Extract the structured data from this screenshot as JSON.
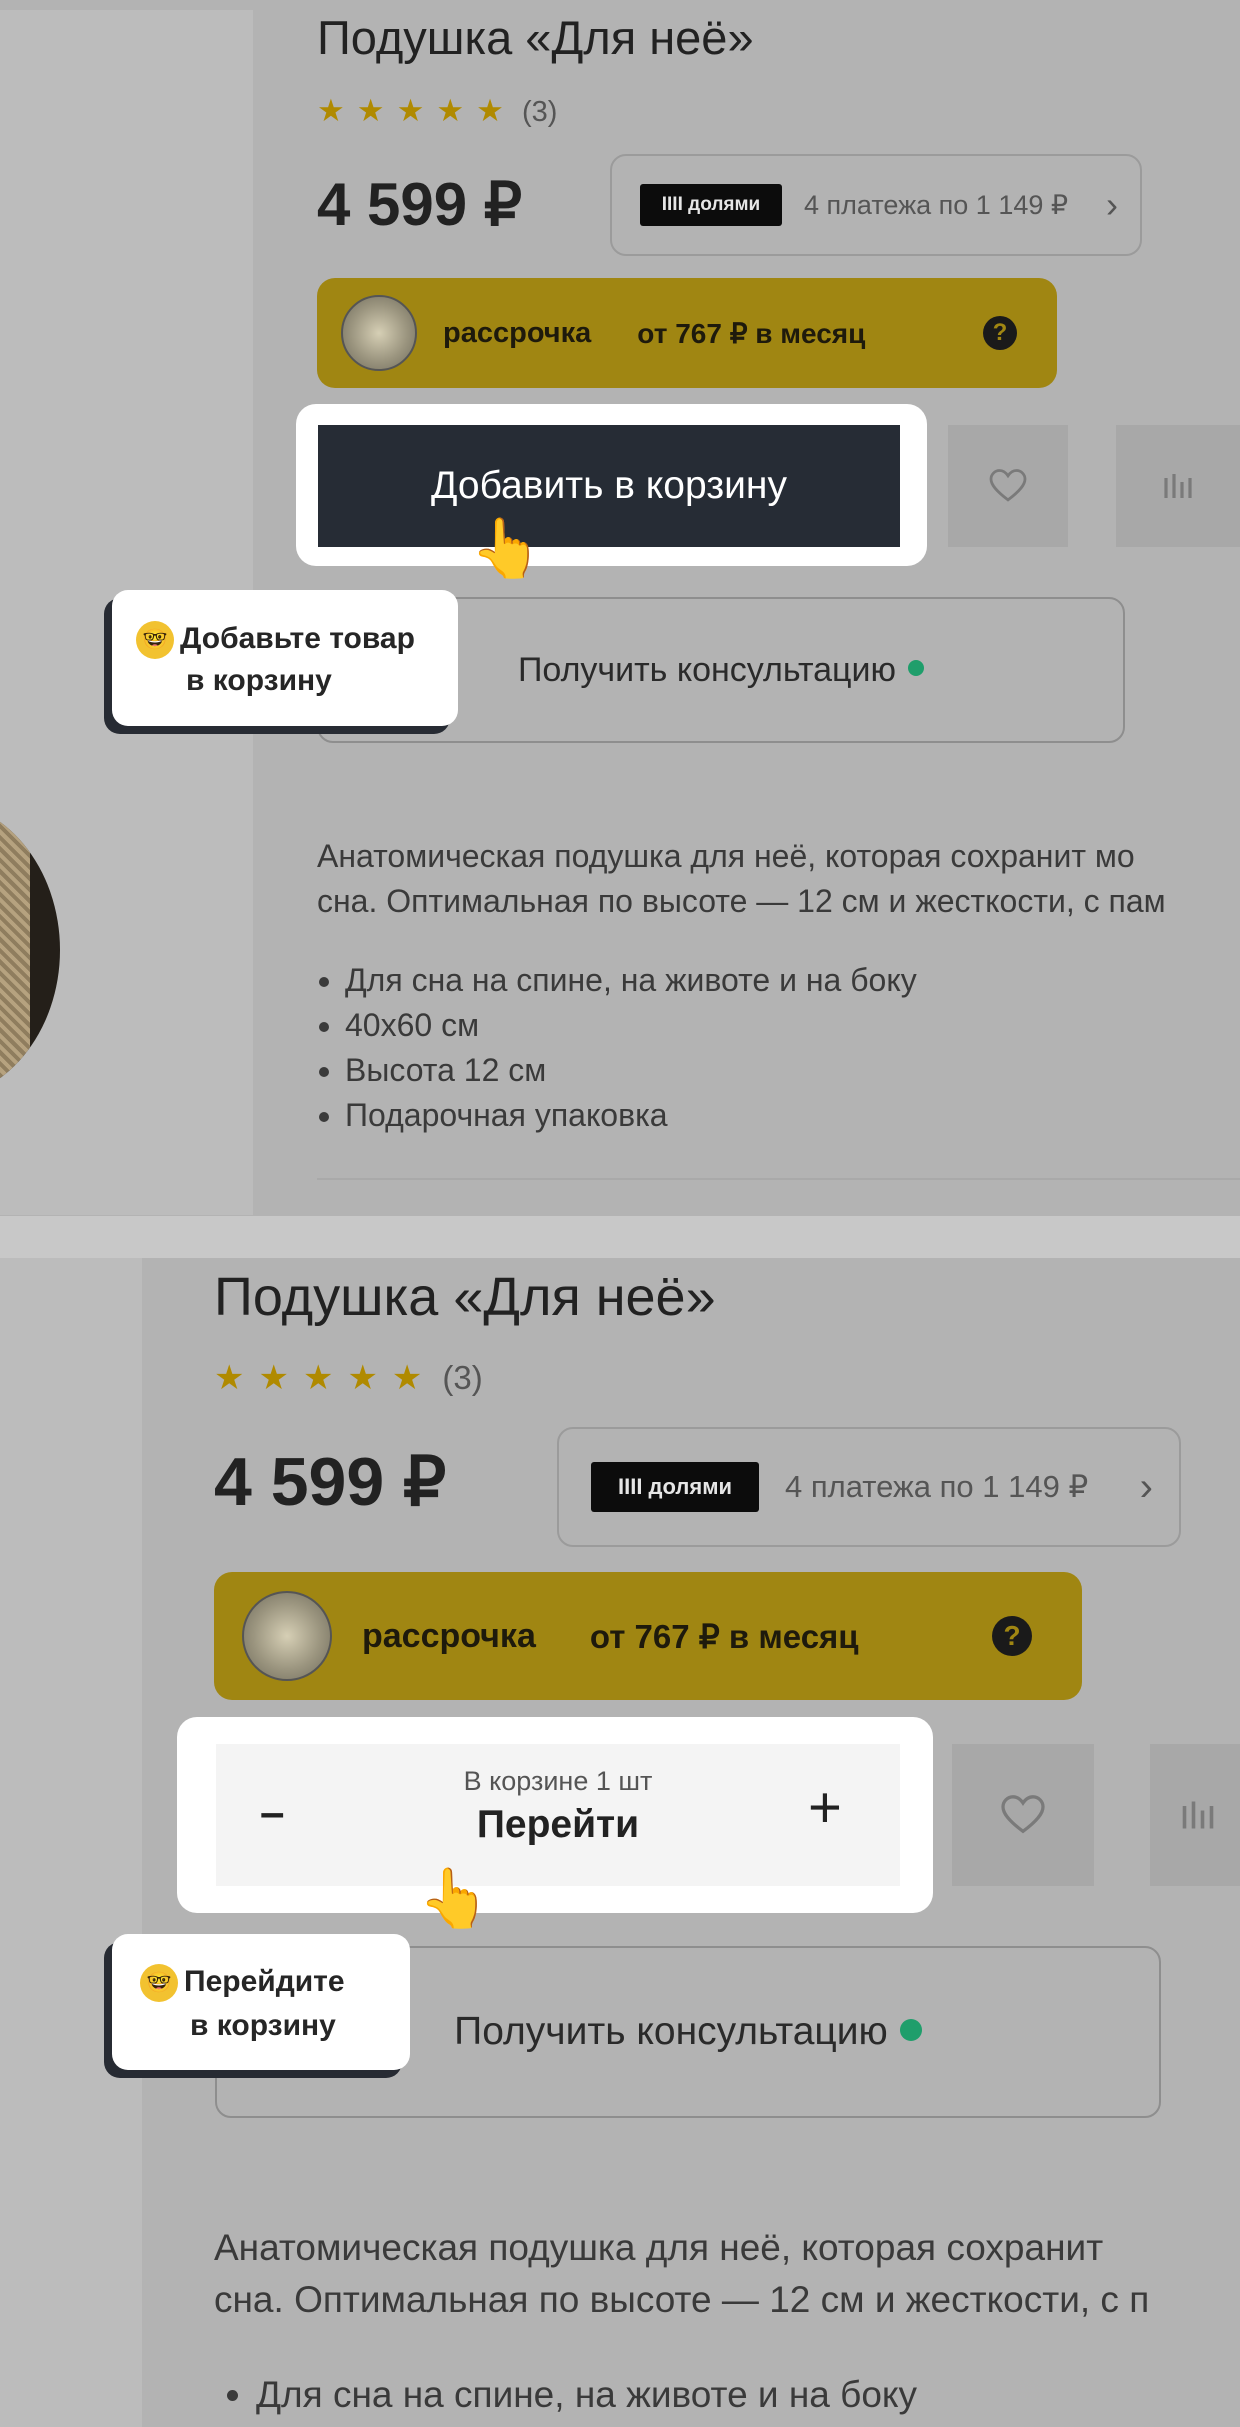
{
  "product": {
    "title": "Подушка «Для неё»",
    "stars": "★★★★★",
    "rating_count": "(3)",
    "price": "4 599 ₽",
    "dolyami": {
      "badge": "IIII долями",
      "text": "4 платежа по 1 149 ₽",
      "chevron": "›"
    },
    "installment": {
      "name": "рассрочка",
      "monthly": "от 767 ₽ в месяц",
      "help": "?"
    },
    "consult_label": "Получить консультацию",
    "description_line1": "Анатомическая подушка для неё, которая сохранит мо",
    "description_line2": "сна. Оптимальная по высоте — 12 см и жесткости, с пам",
    "description_line1_b": "Анатомическая подушка для неё, которая сохранит",
    "description_line2_b": "сна. Оптимальная по высоте — 12 см и жесткости, с п",
    "features": [
      "Для сна на спине, на животе и на боку",
      "40x60 см",
      "Высота 12 см",
      "Подарочная упаковка"
    ]
  },
  "step1": {
    "add_to_cart_label": "Добавить в корзину",
    "tooltip_emoji": "🤓",
    "tooltip_line1": "Добавьте товар",
    "tooltip_line2": "в корзину"
  },
  "step2": {
    "in_cart_text": "В корзине 1 шт",
    "go_label": "Перейти",
    "minus": "–",
    "plus": "+",
    "tooltip_emoji": "🤓",
    "tooltip_line1": "Перейдите",
    "tooltip_line2": "в корзину"
  },
  "icons": {
    "heart": "heart-icon",
    "compare": "compare-icon",
    "hand": "pointing-hand-icon"
  },
  "colors": {
    "overlay": "#b3b3b3",
    "installment": "#a08612",
    "cart_button": "#262c35",
    "tooltip_shadow": "#272b33",
    "online_dot": "#1f9e6b"
  }
}
